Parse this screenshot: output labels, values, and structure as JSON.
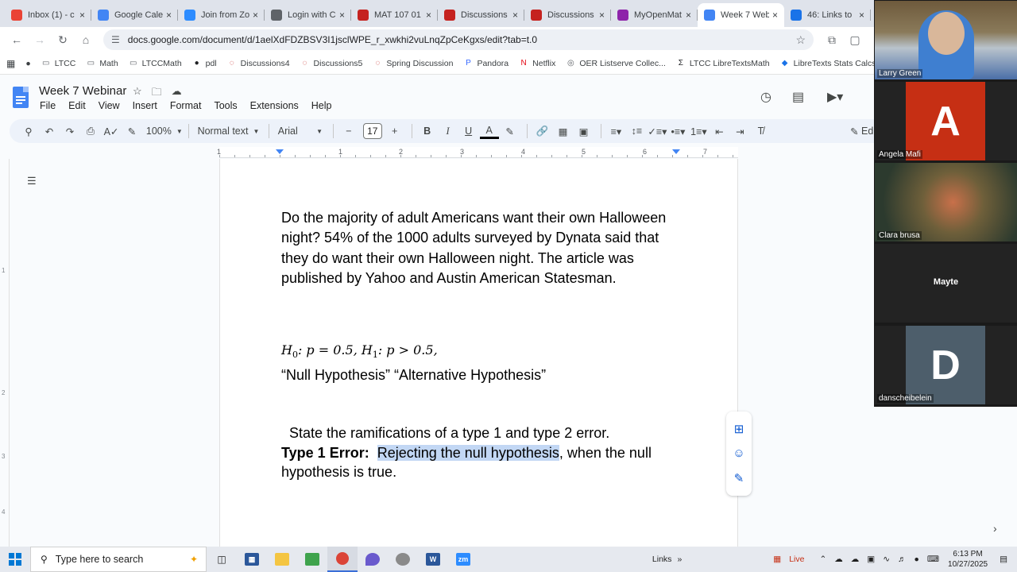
{
  "browser": {
    "tabs": [
      {
        "title": "Inbox (1) - c",
        "icon": "gmail-icon",
        "color": "#ea4335"
      },
      {
        "title": "Google Cale",
        "icon": "calendar-icon",
        "color": "#4285f4"
      },
      {
        "title": "Join from Zo",
        "icon": "zoom-icon",
        "color": "#2d8cff"
      },
      {
        "title": "Login with C",
        "icon": "globe-icon",
        "color": "#5f6368"
      },
      {
        "title": "MAT 107 01",
        "icon": "d2l-icon",
        "color": "#c5221f"
      },
      {
        "title": "Discussions",
        "icon": "d2l-icon",
        "color": "#c5221f"
      },
      {
        "title": "Discussions",
        "icon": "d2l-icon",
        "color": "#c5221f"
      },
      {
        "title": "MyOpenMat",
        "icon": "myopenmath-icon",
        "color": "#8e24aa"
      },
      {
        "title": "Week 7 Web",
        "icon": "docs-icon",
        "color": "#4285f4",
        "active": true
      },
      {
        "title": "46: Links to",
        "icon": "libretexts-icon",
        "color": "#1a73e8"
      }
    ],
    "url": "docs.google.com/document/d/1aelXdFDZBSV3I1jsclWPE_r_xwkhi2vuLnqZpCeKgxs/edit?tab=t.0",
    "bookmarks": [
      {
        "label": "LTCC",
        "icon": "folder-icon"
      },
      {
        "label": "Math",
        "icon": "folder-icon"
      },
      {
        "label": "LTCCMath",
        "icon": "folder-icon"
      },
      {
        "label": "pdl",
        "icon": "github-icon"
      },
      {
        "label": "Discussions4",
        "icon": "d2l-icon"
      },
      {
        "label": "Discussions5",
        "icon": "d2l-icon"
      },
      {
        "label": "Spring Discussion",
        "icon": "d2l-icon"
      },
      {
        "label": "Pandora",
        "icon": "pandora-icon"
      },
      {
        "label": "Netflix",
        "icon": "netflix-icon"
      },
      {
        "label": "OER Listserve Collec...",
        "icon": "globe-icon"
      },
      {
        "label": "LTCC LibreTextsMath",
        "icon": "sigma-icon"
      },
      {
        "label": "LibreTexts Stats Calcs",
        "icon": "libretexts-icon"
      }
    ]
  },
  "docs": {
    "title": "Week 7 Webinar",
    "menu": [
      "File",
      "Edit",
      "View",
      "Insert",
      "Format",
      "Tools",
      "Extensions",
      "Help"
    ],
    "toolbar": {
      "zoom": "100%",
      "style": "Normal text",
      "font": "Arial",
      "font_size": "17",
      "edit_label": "Ed"
    },
    "ruler_numbers": [
      "1",
      "1",
      "2",
      "3",
      "4",
      "5",
      "6",
      "7"
    ],
    "vruler_numbers": [
      "1",
      "2",
      "3",
      "4"
    ]
  },
  "document": {
    "paragraph1": "Do the majority of adult Americans want their own Halloween night?  54% of the 1000 adults surveyed by Dynata said that they do want their own Halloween night.  The article was published by Yahoo and Austin American Statesman.",
    "math": {
      "h0": "H",
      "h0_sub": "0",
      "h0_rest": ": p = 0.5, ",
      "h1": "H",
      "h1_sub": "1",
      "h1_rest": ": p > 0.5,"
    },
    "hypothesis_names": "“Null Hypothesis”   “Alternative Hypothesis”",
    "ramifications": "State the ramifications of a type 1 and type 2 error.",
    "type1_label": "Type 1 Error:",
    "type1_highlight": "Rejecting the null hypothesis",
    "type1_rest": ", when the null hypothesis is true."
  },
  "zoom": {
    "participants": [
      {
        "name": "Larry Green",
        "kind": "video",
        "bg": "#5a6a55"
      },
      {
        "name": "Angela Mafi",
        "kind": "avatar",
        "letter": "A",
        "bg": "#c62f14"
      },
      {
        "name": "Clara brusa",
        "kind": "image",
        "bg": "#3c4a3a"
      },
      {
        "name": "Mayte",
        "kind": "name"
      },
      {
        "name": "danscheibelein",
        "kind": "avatar",
        "letter": "D",
        "bg": "#4d5e6b"
      }
    ]
  },
  "taskbar": {
    "search_placeholder": "Type here to search",
    "links_label": "Links",
    "live_label": "Live",
    "time": "6:13 PM",
    "date": "10/27/2025"
  }
}
